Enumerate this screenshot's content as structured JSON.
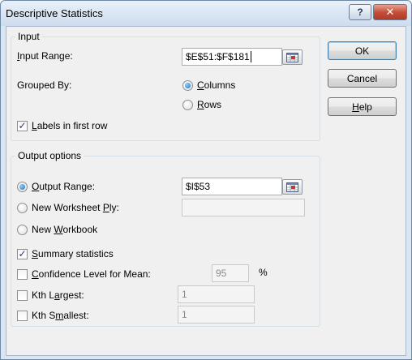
{
  "window": {
    "title": "Descriptive Statistics",
    "help_glyph": "?",
    "close_glyph": "✕"
  },
  "input_group": {
    "legend": "Input",
    "input_range": {
      "label_pre": "",
      "label_ul": "I",
      "label_post": "nput Range:",
      "value": "$E$51:$F$181"
    },
    "grouped_by": {
      "label": "Grouped By:",
      "columns": {
        "pre": "",
        "ul": "C",
        "post": "olumns",
        "selected": true
      },
      "rows": {
        "pre": "",
        "ul": "R",
        "post": "ows",
        "selected": false
      }
    },
    "labels_first_row": {
      "pre": "",
      "ul": "L",
      "post": "abels in first row",
      "checked": true
    }
  },
  "output_group": {
    "legend": "Output options",
    "output_range": {
      "pre": "",
      "ul": "O",
      "post": "utput Range:",
      "value": "$I$53",
      "selected": true
    },
    "new_worksheet": {
      "pre": "New Worksheet ",
      "ul": "P",
      "post": "ly:",
      "value": "",
      "selected": false
    },
    "new_workbook": {
      "pre": "New ",
      "ul": "W",
      "post": "orkbook",
      "selected": false
    },
    "summary_statistics": {
      "pre": "",
      "ul": "S",
      "post": "ummary statistics",
      "checked": true
    },
    "confidence_level": {
      "pre": "",
      "ul": "C",
      "post": "onfidence Level for Mean:",
      "checked": false,
      "value": "95",
      "unit": "%"
    },
    "kth_largest": {
      "pre": "Kth L",
      "ul": "a",
      "post": "rgest:",
      "checked": false,
      "value": "1"
    },
    "kth_smallest": {
      "pre": "Kth S",
      "ul": "m",
      "post": "allest:",
      "checked": false,
      "value": "1"
    }
  },
  "buttons": {
    "ok": "OK",
    "cancel": "Cancel",
    "help": {
      "pre": "",
      "ul": "H",
      "post": "elp"
    }
  },
  "icons": {
    "collapse_dialog": "range-selector-icon"
  }
}
